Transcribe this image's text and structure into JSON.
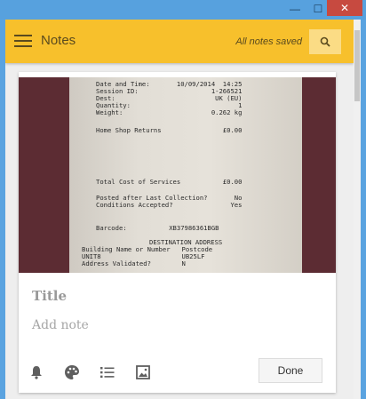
{
  "window": {
    "minimize_glyph": "—",
    "maximize_glyph": "☐",
    "close_glyph": "✕"
  },
  "appbar": {
    "title": "Notes",
    "status": "All notes saved",
    "menu_icon": "hamburger-icon",
    "search_icon": "search-icon",
    "color": "#f7c02c"
  },
  "note": {
    "title_placeholder": "Title",
    "note_placeholder": "Add note",
    "done_label": "Done",
    "tools": [
      "bell-icon",
      "palette-icon",
      "list-icon",
      "image-icon"
    ]
  },
  "receipt": {
    "lines": [
      "Date and Time:       10/09/2014  14:25",
      "Session ID:                   1-266521",
      "Dest:                          UK (EU)",
      "Quantity:                            1",
      "Weight:                       0.262 kg",
      "Home Shop Returns                £0.00",
      "Total Cost of Services           £0.00",
      "Posted after Last Collection?       No",
      "Conditions Accepted?               Yes",
      "Barcode:           XB37986361BGB",
      "DESTINATION ADDRESS",
      "Building Name or Number   Postcode",
      "UNIT8                     UB25LF",
      "Address Validated?        N"
    ]
  }
}
